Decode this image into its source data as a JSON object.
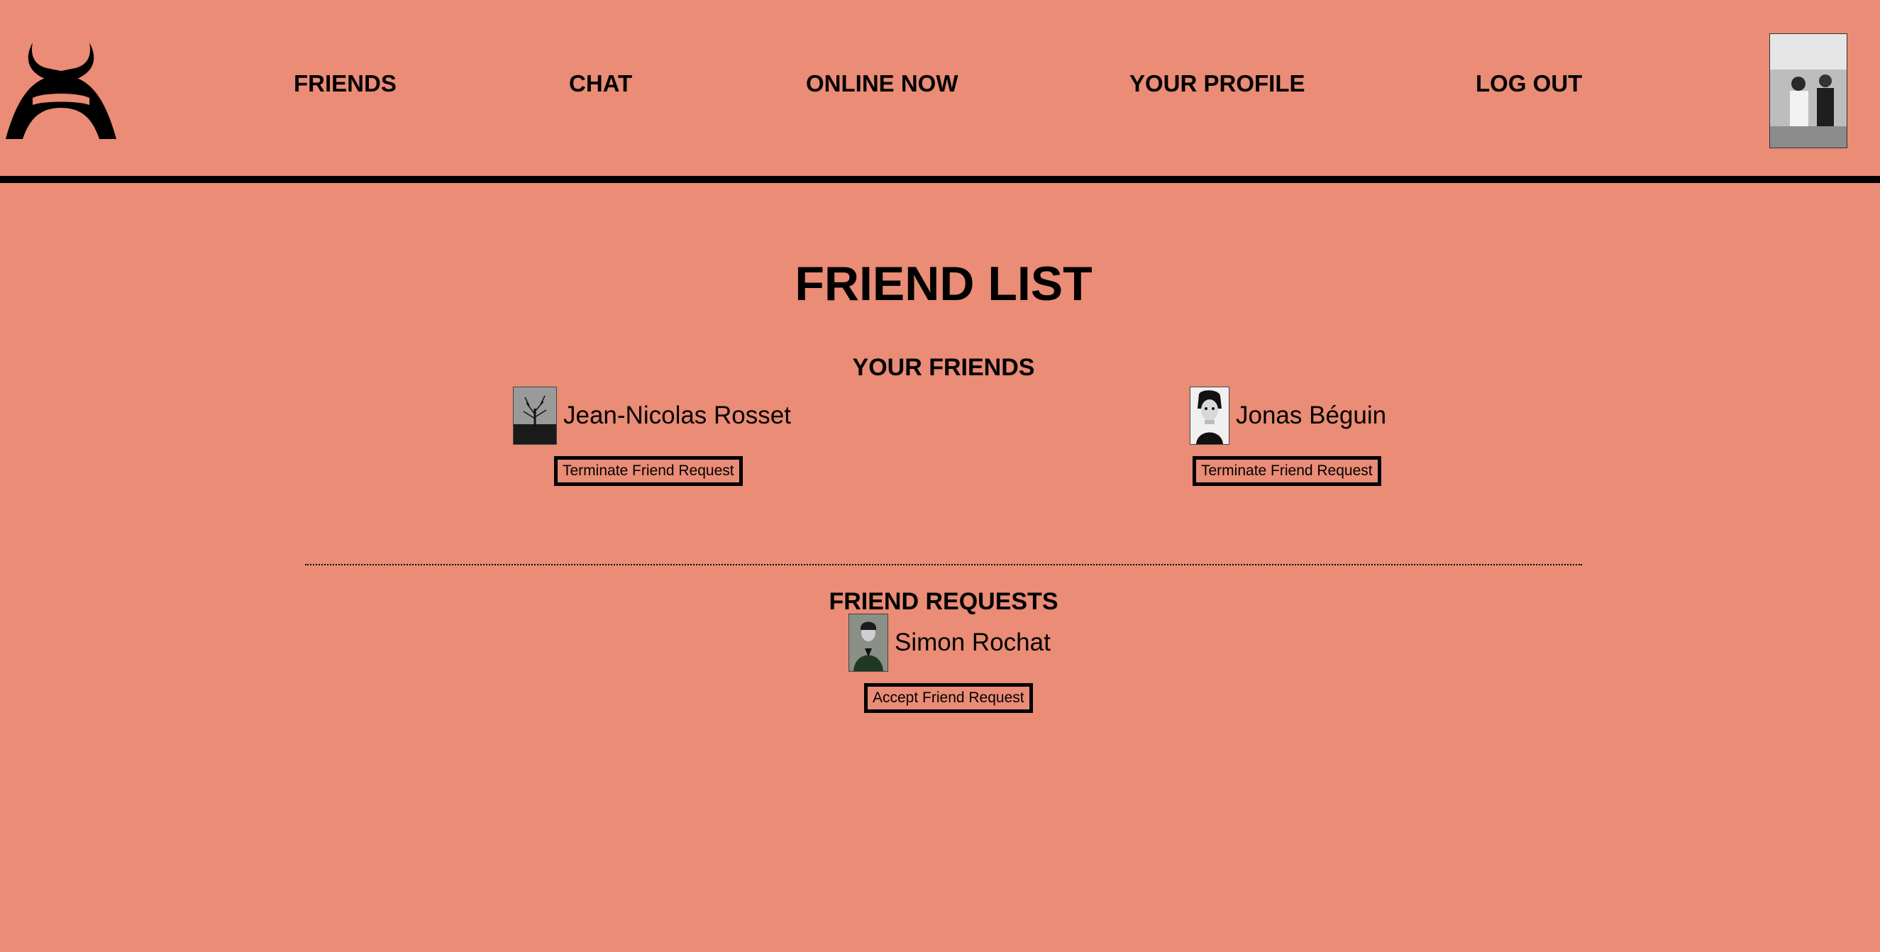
{
  "nav": {
    "items": [
      {
        "label": "FRIENDS"
      },
      {
        "label": "CHAT"
      },
      {
        "label": "ONLINE NOW"
      },
      {
        "label": "YOUR PROFILE"
      },
      {
        "label": "LOG OUT"
      }
    ]
  },
  "page": {
    "title": "FRIEND LIST"
  },
  "friends": {
    "heading": "YOUR FRIENDS",
    "items": [
      {
        "name": "Jean-Nicolas Rosset",
        "action": "Terminate Friend Request"
      },
      {
        "name": "Jonas Béguin",
        "action": "Terminate Friend Request"
      }
    ]
  },
  "requests": {
    "heading": "FRIEND REQUESTS",
    "items": [
      {
        "name": "Simon Rochat",
        "action": "Accept Friend Request"
      }
    ]
  },
  "colors": {
    "background": "#ea8c76",
    "foreground": "#000000"
  },
  "icons": {
    "logo": "horned-helmet-logo",
    "avatar": "user-avatar"
  }
}
